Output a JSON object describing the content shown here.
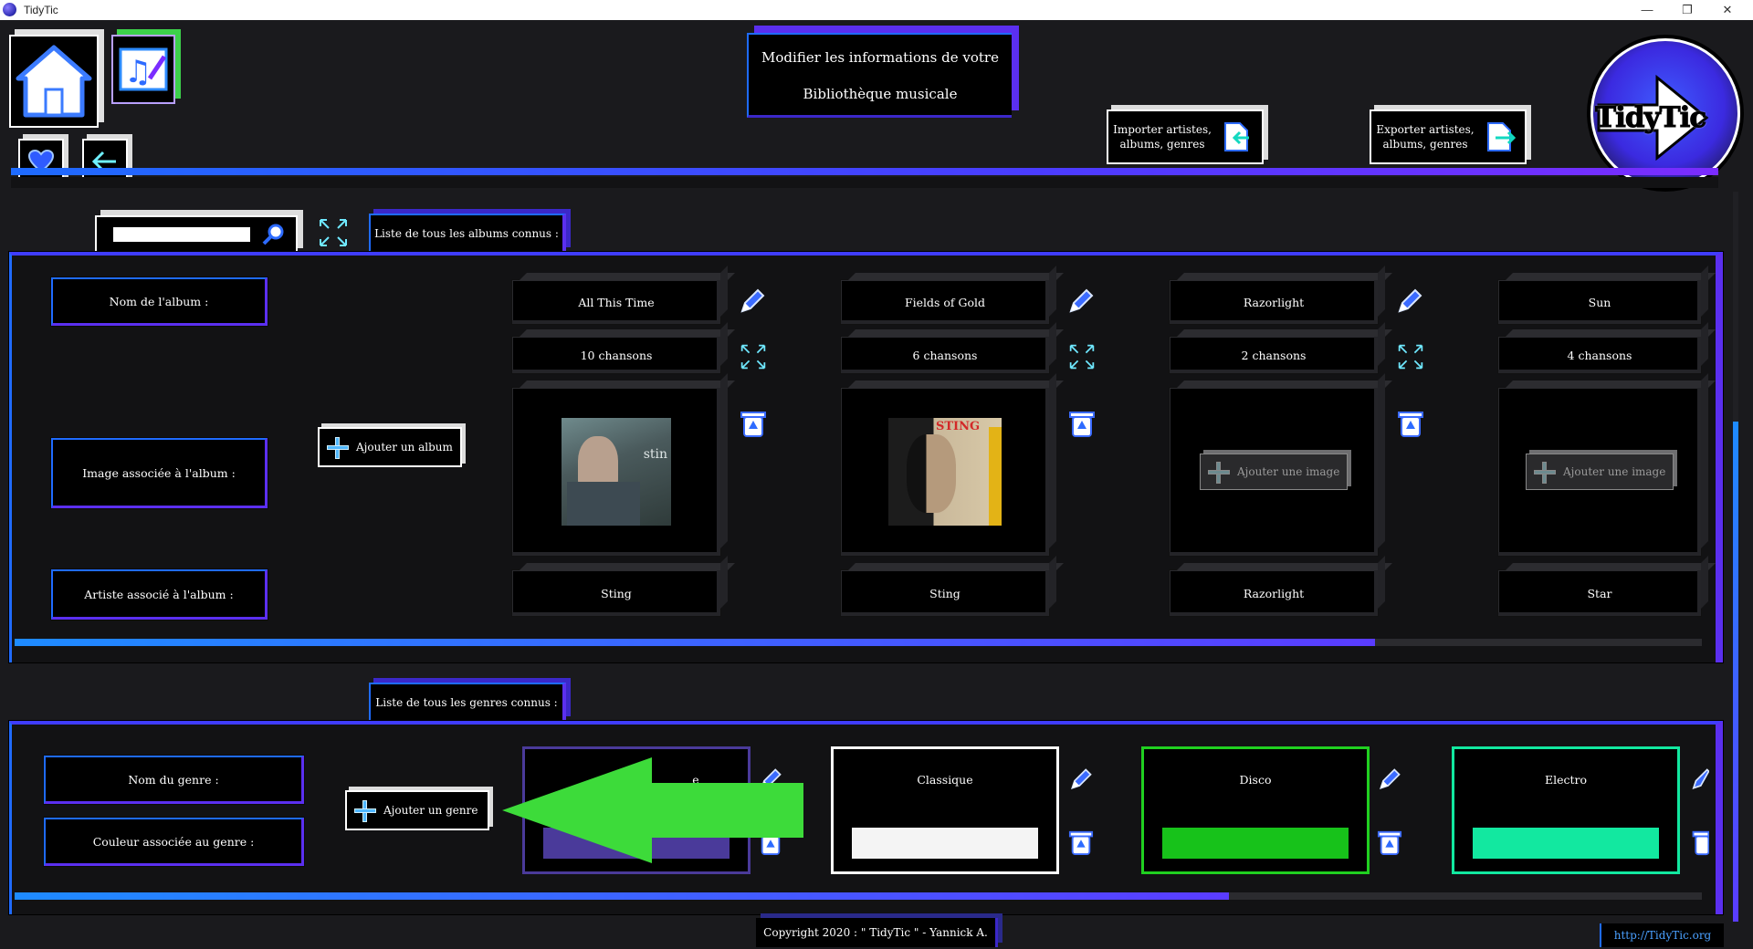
{
  "window": {
    "title": "TidyTic",
    "controls": [
      "—",
      "❐",
      "✕"
    ]
  },
  "header": {
    "title_line1": "Modifier les informations de votre",
    "title_line2": "Bibliothèque musicale",
    "import_label": "Importer artistes, albums, genres",
    "export_label": "Exporter artistes, albums, genres",
    "logo_text": "TidyTic"
  },
  "nav": {
    "home_icon": "home-icon",
    "music_edit_icon": "music-edit-icon",
    "favorites_icon": "heart-icon",
    "back_icon": "back-arrow-icon"
  },
  "albums": {
    "search_placeholder": "",
    "tab_label": "Liste de tous les albums connus :",
    "row_labels": {
      "name": "Nom de l'album :",
      "image": "Image associée à l'album :",
      "artist": "Artiste associé à l'album :"
    },
    "add_album_label": "Ajouter un album",
    "add_image_label": "Ajouter une image",
    "items": [
      {
        "name": "All This Time",
        "songs": "10 chansons",
        "artist": "Sting",
        "has_image": true,
        "cover": "sting-1"
      },
      {
        "name": "Fields of Gold",
        "songs": "6 chansons",
        "artist": "Sting",
        "has_image": true,
        "cover": "sting-2"
      },
      {
        "name": "Razorlight",
        "songs": "2 chansons",
        "artist": "Razorlight",
        "has_image": false
      },
      {
        "name": "Sun",
        "songs": "4 chansons",
        "artist": "Star",
        "has_image": false
      }
    ],
    "cover_text": {
      "c1": "stin",
      "c2": "STING"
    },
    "scroll_position": 0.8
  },
  "genres": {
    "tab_label": "Liste de tous les genres connus :",
    "row_labels": {
      "name": "Nom du genre :",
      "color": "Couleur associée au genre :"
    },
    "add_genre_label": "Ajouter un genre",
    "items": [
      {
        "name": "e",
        "color": "#4a3a9a",
        "border": "#4a3a9a"
      },
      {
        "name": "Classique",
        "color": "#f4f4f4",
        "border": "#ffffff"
      },
      {
        "name": "Disco",
        "color": "#17c21a",
        "border": "#20d020"
      },
      {
        "name": "Electro",
        "color": "#12e8a0",
        "border": "#12e8a0"
      }
    ],
    "scroll_position": 0.72,
    "overlay_arrow_color": "#3ddb3a"
  },
  "footer": {
    "copyright": "Copyright 2020 : \" TidyTic \" - Yannick A.",
    "link": "http://TidyTic.org"
  }
}
